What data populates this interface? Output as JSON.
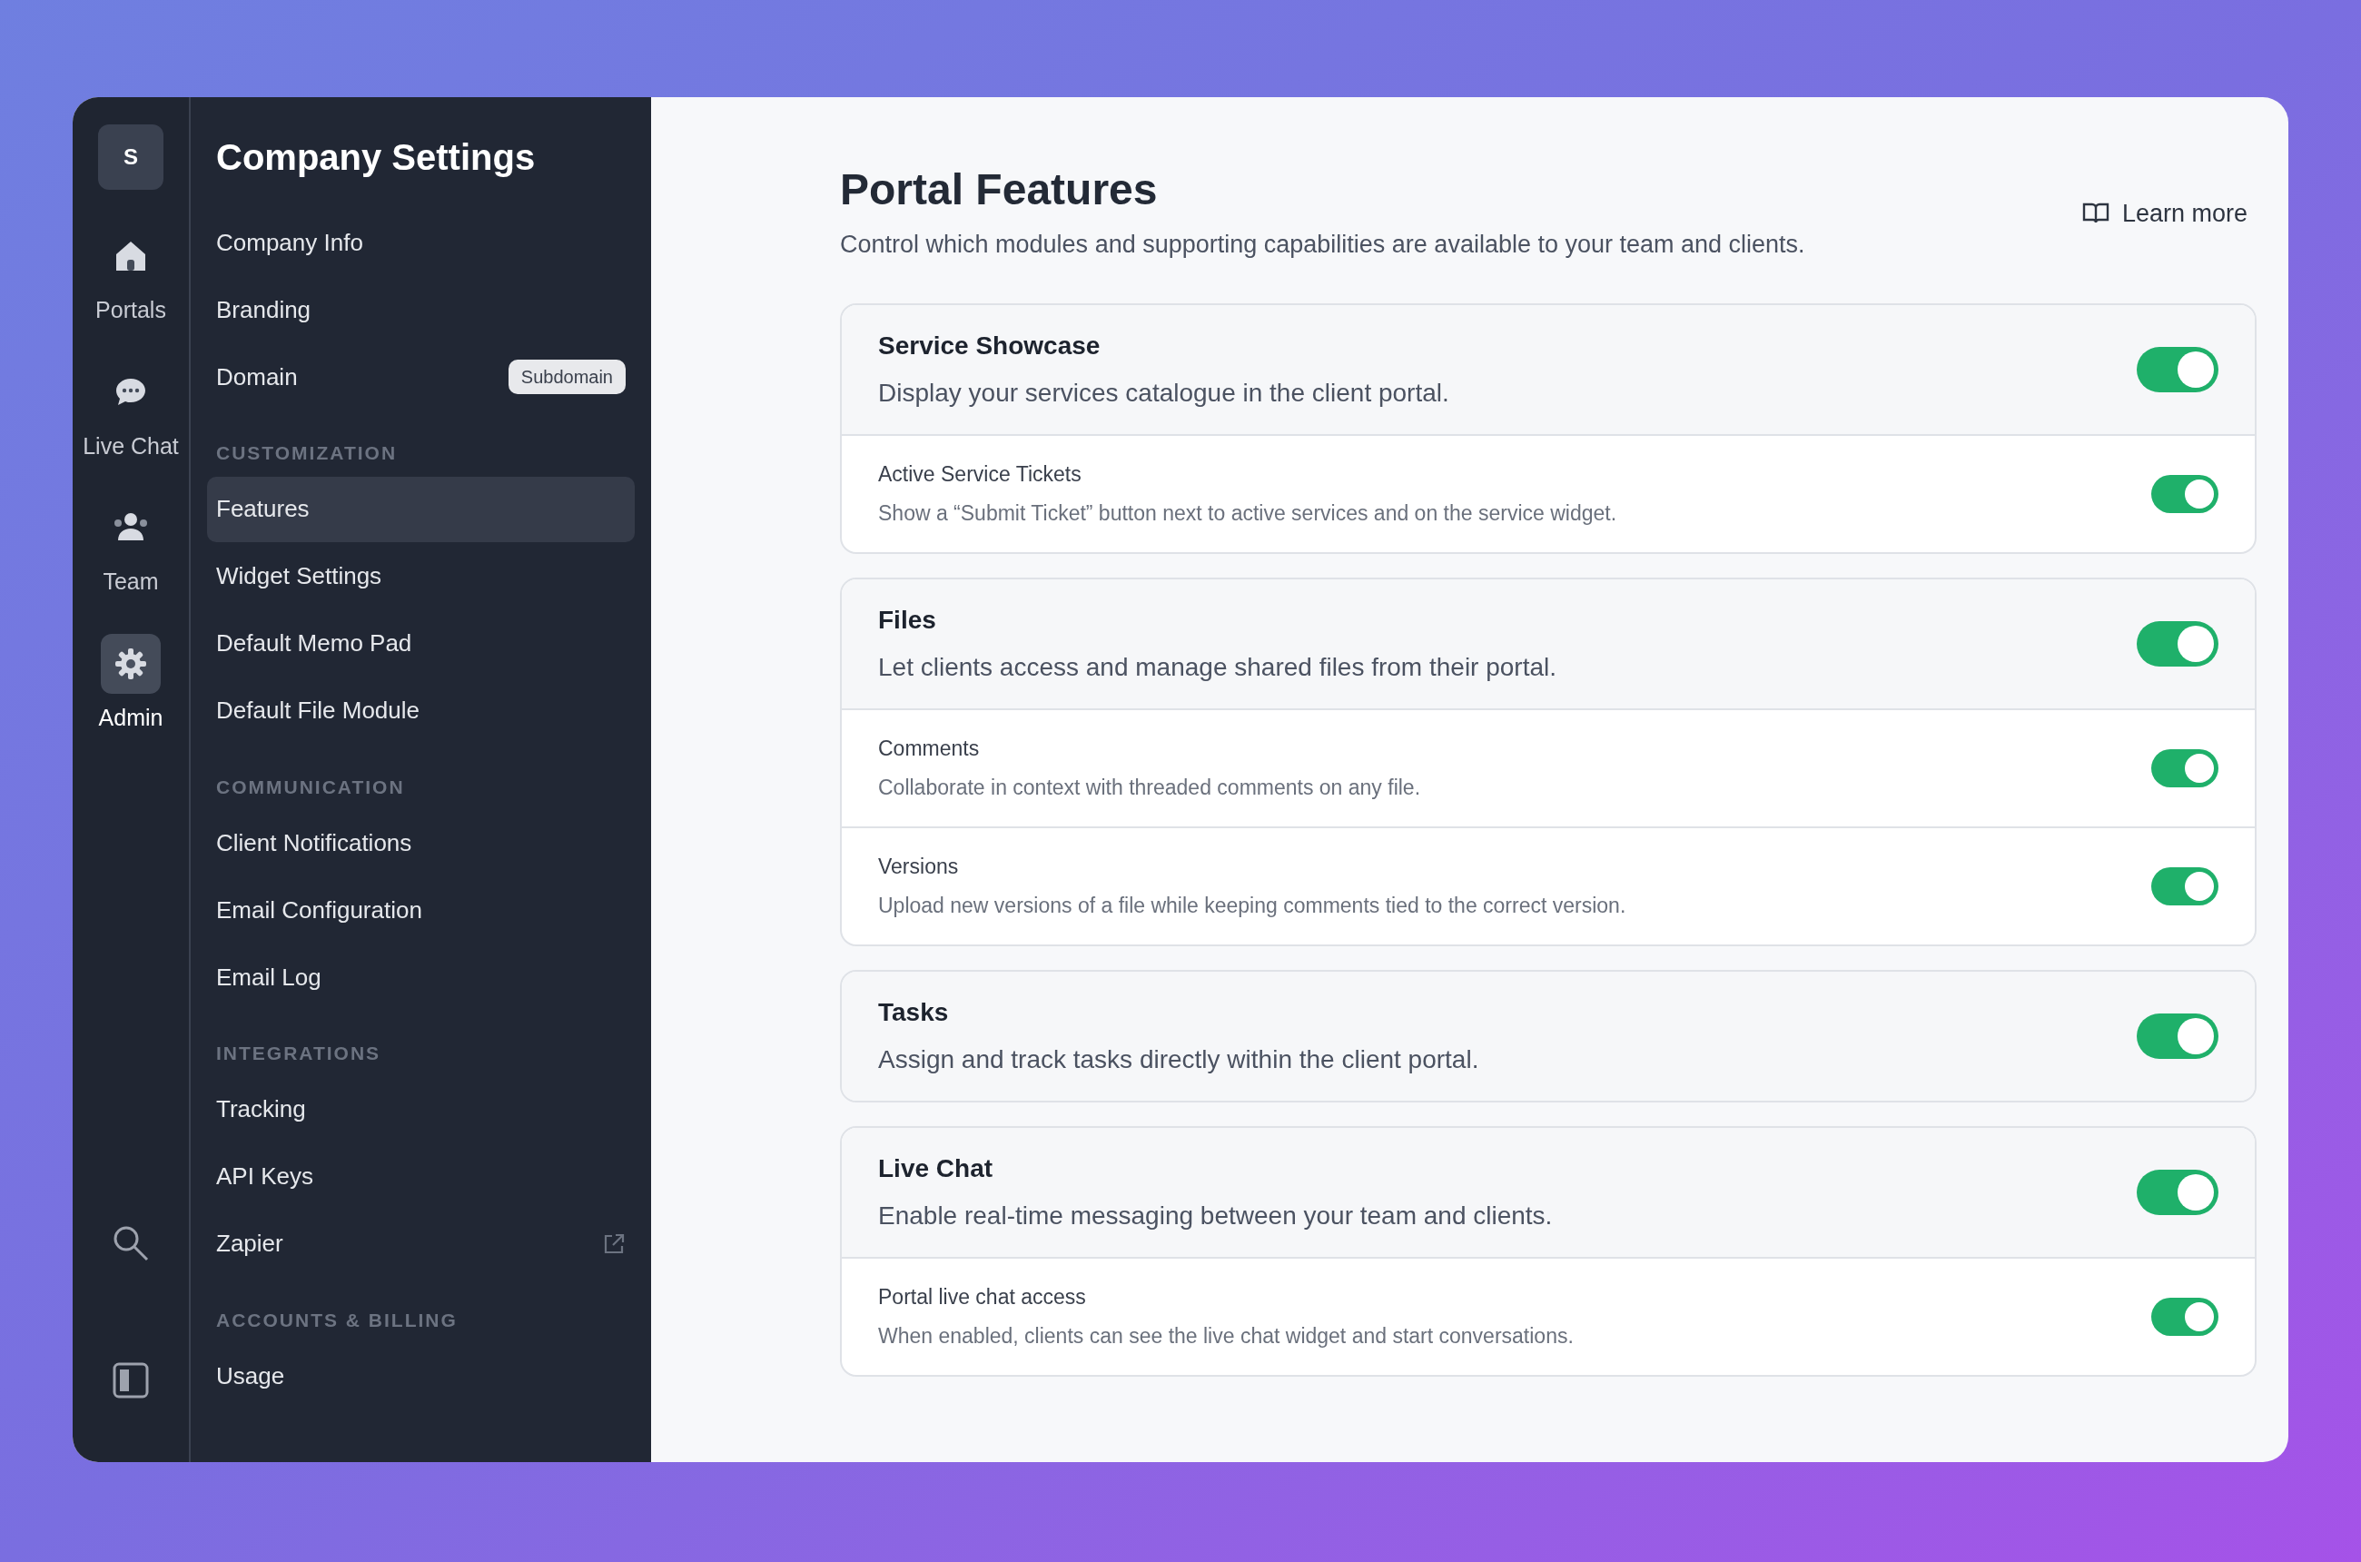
{
  "rail": {
    "avatar": "S",
    "items": [
      {
        "label": "Portals",
        "kind": "home",
        "selected": false
      },
      {
        "label": "Live Chat",
        "kind": "chat",
        "selected": false
      },
      {
        "label": "Team",
        "kind": "team",
        "selected": false
      },
      {
        "label": "Admin",
        "kind": "gear",
        "selected": true
      }
    ]
  },
  "sidebar": {
    "title": "Company Settings",
    "sections": [
      {
        "items": [
          {
            "label": "Company Info",
            "selected": false
          },
          {
            "label": "Branding",
            "selected": false
          },
          {
            "label": "Domain",
            "selected": false,
            "badge": "Subdomain"
          }
        ]
      },
      {
        "heading": "CUSTOMIZATION",
        "items": [
          {
            "label": "Features",
            "selected": true
          },
          {
            "label": "Widget Settings",
            "selected": false
          },
          {
            "label": "Default Memo Pad",
            "selected": false
          },
          {
            "label": "Default File Module",
            "selected": false
          }
        ]
      },
      {
        "heading": "COMMUNICATION",
        "items": [
          {
            "label": "Client Notifications",
            "selected": false
          },
          {
            "label": "Email Configuration",
            "selected": false
          },
          {
            "label": "Email Log",
            "selected": false
          }
        ]
      },
      {
        "heading": "INTEGRATIONS",
        "items": [
          {
            "label": "Tracking",
            "selected": false
          },
          {
            "label": "API Keys",
            "selected": false
          },
          {
            "label": "Zapier",
            "selected": false,
            "external": true
          }
        ]
      },
      {
        "heading": "ACCOUNTS & BILLING",
        "items": [
          {
            "label": "Usage",
            "selected": false
          }
        ]
      }
    ]
  },
  "page": {
    "title": "Portal Features",
    "subtitle": "Control which modules and supporting capabilities are available to your team and clients.",
    "learn_more": "Learn more"
  },
  "cards": [
    {
      "title": "Service Showcase",
      "description": "Display your services catalogue in the client portal.",
      "on": true,
      "options": [
        {
          "title": "Active Service Tickets",
          "description": "Show a “Submit Ticket” button next to active services and on the service widget.",
          "on": true
        }
      ]
    },
    {
      "title": "Files",
      "description": "Let clients access and manage shared files from their portal.",
      "on": true,
      "options": [
        {
          "title": "Comments",
          "description": "Collaborate in context with threaded comments on any file.",
          "on": true
        },
        {
          "title": "Versions",
          "description": "Upload new versions of a file while keeping comments tied to the correct version.",
          "on": true
        }
      ]
    },
    {
      "title": "Tasks",
      "description": "Assign and track tasks directly within the client portal.",
      "on": true
    },
    {
      "title": "Live Chat",
      "description": "Enable real-time messaging between your team and clients.",
      "on": true,
      "options": [
        {
          "title": "Portal live chat access",
          "description": "When enabled, clients can see the live chat widget and start conversations.",
          "on": true
        }
      ]
    }
  ]
}
